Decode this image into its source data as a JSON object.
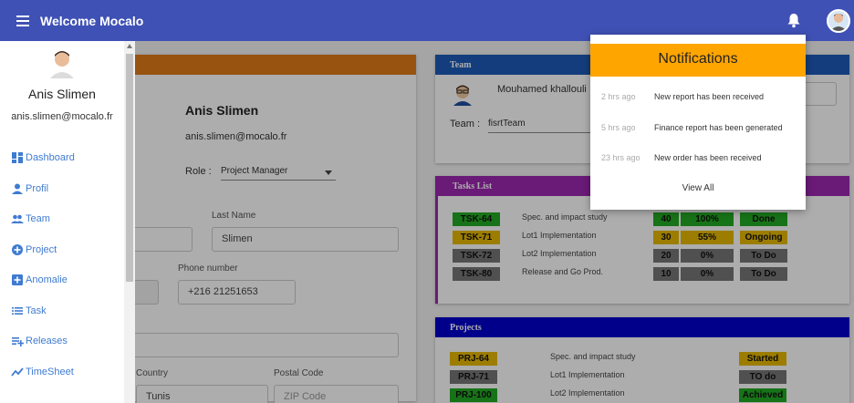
{
  "header": {
    "title": "Welcome Mocalo"
  },
  "sidebar": {
    "name": "Anis Slimen",
    "email": "anis.slimen@mocalo.fr",
    "items": [
      {
        "label": "Dashboard",
        "icon": "dashboard-icon"
      },
      {
        "label": "Profil",
        "icon": "person-icon"
      },
      {
        "label": "Team",
        "icon": "team-icon"
      },
      {
        "label": "Project",
        "icon": "add-circle-icon"
      },
      {
        "label": "Anomalie",
        "icon": "add-box-icon"
      },
      {
        "label": "Task",
        "icon": "list-icon"
      },
      {
        "label": "Releases",
        "icon": "playlist-add-icon"
      },
      {
        "label": "TimeSheet",
        "icon": "timeline-icon"
      }
    ]
  },
  "profile": {
    "name": "Anis Slimen",
    "email": "anis.slimen@mocalo.fr",
    "role_label": "Role :",
    "role_value": "Project Manager",
    "last_name_label": "Last Name",
    "last_name_value": "Slimen",
    "phone_label": "Phone number",
    "phone_value": "+216 21251653",
    "country_label": "Country",
    "country_value": "Tunis",
    "postal_label": "Postal Code",
    "postal_placeholder": "ZIP Code"
  },
  "team": {
    "title": "Team",
    "member": "Mouhamed khallouli",
    "team_label": "Team :",
    "team_value": "fisrtTeam"
  },
  "tasks": {
    "title": "Tasks List",
    "rows": [
      {
        "id": "TSK-64",
        "name": "Spec. and impact study",
        "hours": "40",
        "pct": "100%",
        "status": "Done"
      },
      {
        "id": "TSK-71",
        "name": "Lot1 Implementation",
        "hours": "30",
        "pct": "55%",
        "status": "Ongoing"
      },
      {
        "id": "TSK-72",
        "name": "Lot2 Implementation",
        "hours": "20",
        "pct": "0%",
        "status": "To Do"
      },
      {
        "id": "TSK-80",
        "name": "Release and Go Prod.",
        "hours": "10",
        "pct": "0%",
        "status": "To Do"
      }
    ]
  },
  "projects": {
    "title": "Projects",
    "rows": [
      {
        "id": "PRJ-64",
        "name": "Spec. and impact study",
        "status": "Started"
      },
      {
        "id": "PRJ-71",
        "name": "Lot1 Implementation",
        "status": "TO do"
      },
      {
        "id": "PRJ-100",
        "name": "Lot2 Implementation",
        "status": "Achieved"
      }
    ]
  },
  "notifications": {
    "title": "Notifications",
    "items": [
      {
        "time": "2 hrs ago",
        "text": "New report has been received"
      },
      {
        "time": "5 hrs ago",
        "text": "Finance report has been generated"
      },
      {
        "time": "23 hrs ago",
        "text": "New order has been received"
      }
    ],
    "view_all": "View All"
  },
  "colors": {
    "topbar": "#3f51b5",
    "notif_header": "#ffa500",
    "tasks_header": "#9c27b0",
    "projects_header": "#0000cc",
    "green": "#22aa22",
    "yellow": "#e6b800",
    "grey": "#777777"
  }
}
